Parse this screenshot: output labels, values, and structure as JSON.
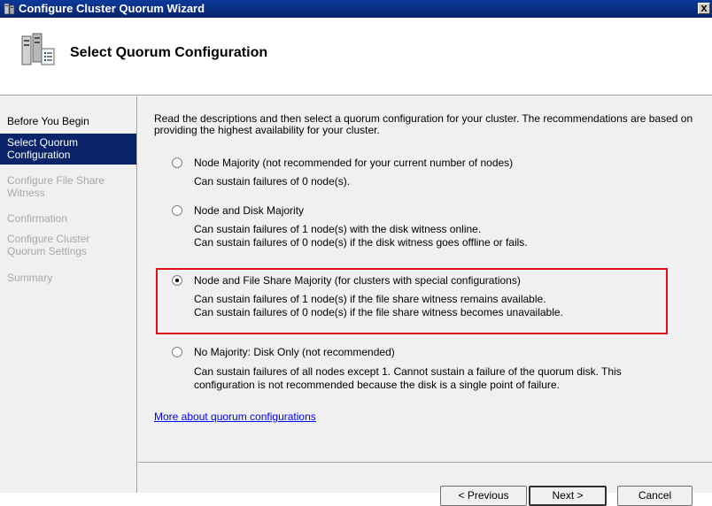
{
  "window": {
    "title": "Configure Cluster Quorum Wizard",
    "close_glyph": "x"
  },
  "header": {
    "title": "Select Quorum Configuration",
    "icon": "cluster-servers-icon"
  },
  "sidebar": {
    "steps": [
      {
        "label": "Before You Begin",
        "state": "done"
      },
      {
        "label": "Select Quorum Configuration",
        "state": "current"
      },
      {
        "label": "Configure File Share Witness",
        "state": "disabled"
      },
      {
        "label": "Confirmation",
        "state": "disabled"
      },
      {
        "label": "Configure Cluster Quorum Settings",
        "state": "disabled"
      },
      {
        "label": "Summary",
        "state": "disabled"
      }
    ]
  },
  "main": {
    "intro": "Read the descriptions and then select a quorum configuration for your cluster. The recommendations are based on providing the highest availability for your cluster.",
    "options": [
      {
        "label": "Node Majority (not recommended for your current number of nodes)",
        "desc": [
          "Can sustain failures of 0 node(s)."
        ],
        "checked": false
      },
      {
        "label": "Node and Disk Majority",
        "desc": [
          "Can sustain failures of 1 node(s) with the disk witness online.",
          "Can sustain failures of 0 node(s) if the disk witness goes offline or fails."
        ],
        "checked": false
      },
      {
        "label": "Node and File Share Majority (for clusters with special configurations)",
        "desc": [
          "Can sustain failures of 1 node(s) if the file share witness remains available.",
          "Can sustain failures of 0 node(s) if the file share witness becomes unavailable."
        ],
        "checked": true
      },
      {
        "label": "No Majority: Disk Only (not recommended)",
        "desc": [
          "Can sustain failures of all nodes except 1. Cannot sustain a failure of the quorum disk. This",
          "configuration is not recommended because the disk is a single point of failure."
        ],
        "checked": false
      }
    ],
    "link": "More about quorum configurations"
  },
  "buttons": {
    "previous": "< Previous",
    "next": "Next >",
    "cancel": "Cancel"
  },
  "colors": {
    "selection": "#0a246a",
    "highlight_box": "#e0101a",
    "link": "#0000ee"
  }
}
